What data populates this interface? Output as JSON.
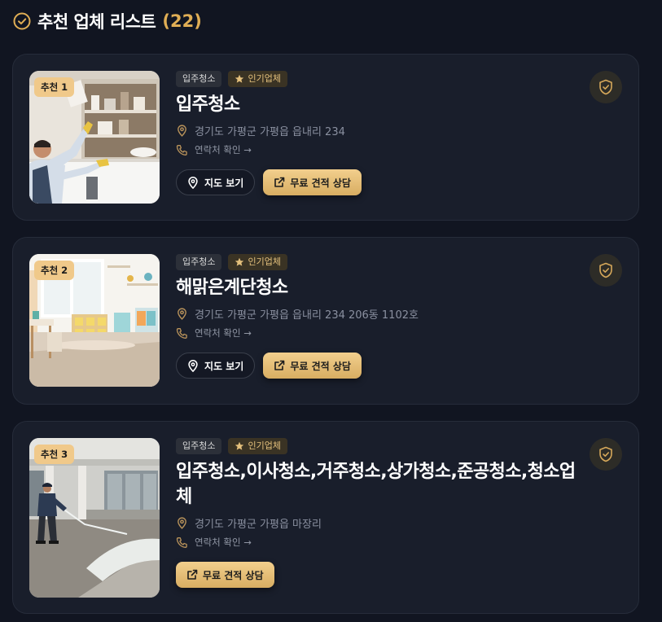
{
  "header": {
    "title": "추천 업체 리스트",
    "count": "(22)",
    "icon": "check-circle-icon"
  },
  "colors": {
    "background": "#111521",
    "card": "#191e2b",
    "accent": "#e0ae55",
    "button_gold": "#e6bd74"
  },
  "cards": [
    {
      "rank": "추천 1",
      "tags": {
        "category": "입주청소",
        "popular": "인기업체"
      },
      "name": "입주청소",
      "address": "경기도 가평군 가평읍 읍내리 234",
      "contact": "연락처 확인 →",
      "map_label": "지도 보기",
      "quote_label": "무료 견적 상담",
      "image": "worker-cleaning-kitchen-cabinet"
    },
    {
      "rank": "추천 2",
      "tags": {
        "category": "입주청소",
        "popular": "인기업체"
      },
      "name": "해맑은계단청소",
      "address": "경기도 가평군 가평읍 읍내리 234 206동 1102호",
      "contact": "연락처 확인 →",
      "map_label": "지도 보기",
      "quote_label": "무료 견적 상담",
      "image": "bright-clean-living-room"
    },
    {
      "rank": "추천 3",
      "tags": {
        "category": "입주청소",
        "popular": "인기업체"
      },
      "name": "입주청소,이사청소,거주청소,상가청소,준공청소,청소업체",
      "address": "경기도 가평군 가평읍 마장리",
      "contact": "연락처 확인 →",
      "quote_label": "무료 견적 상담",
      "image": "worker-pressure-washing-pavement"
    }
  ]
}
